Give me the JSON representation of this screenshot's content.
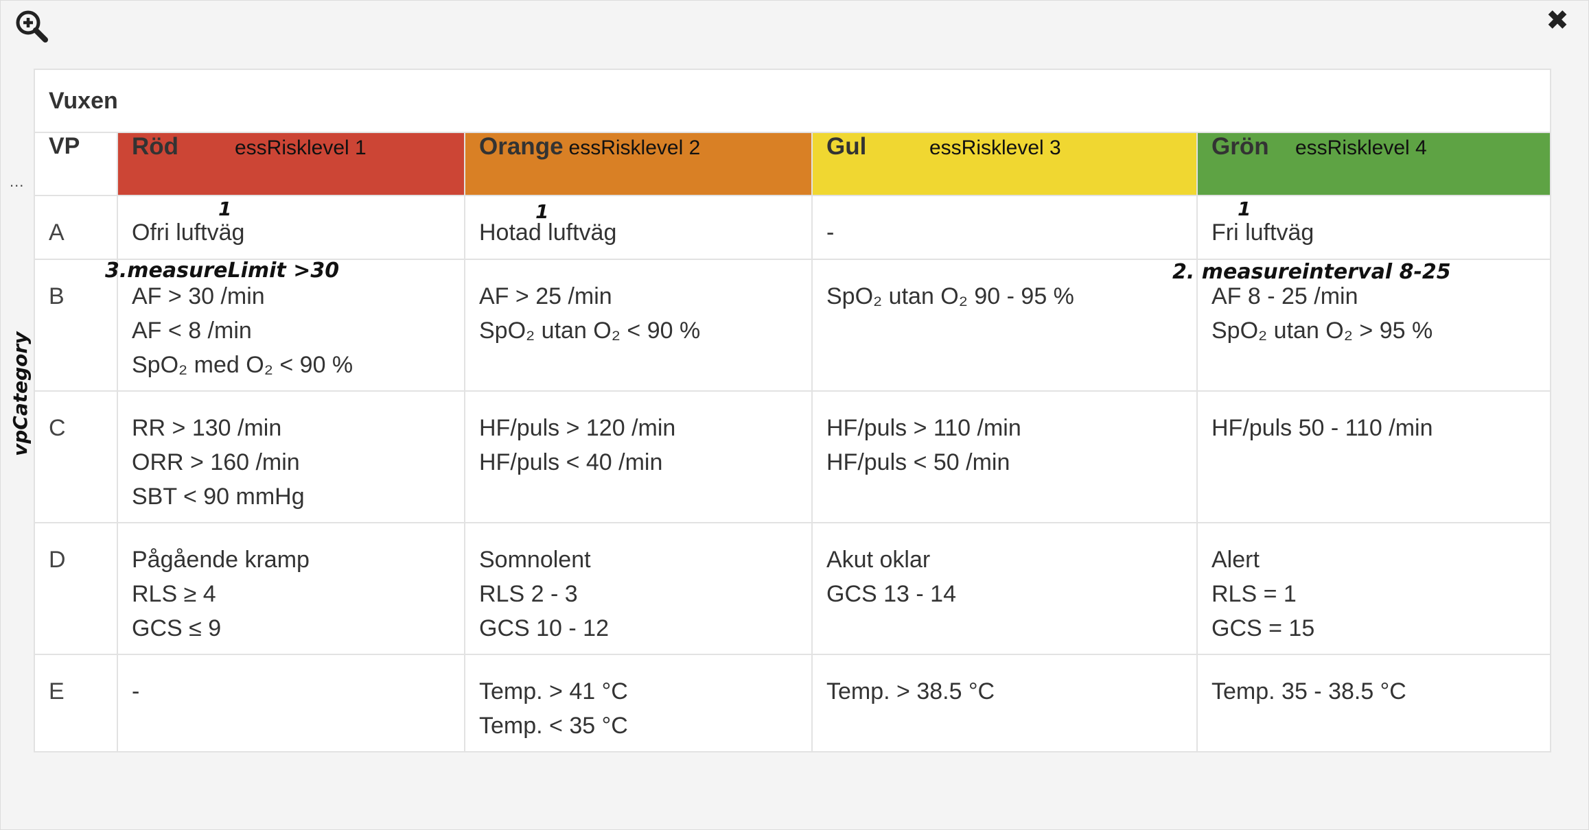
{
  "toolbar": {
    "zoom_icon": "zoom-in-icon",
    "close_icon": "close-icon",
    "close_glyph": "✖",
    "dots": "..."
  },
  "side_label": "vpCategory",
  "table": {
    "title": "Vuxen",
    "vp_header": "VP",
    "levels": [
      {
        "name": "Röd",
        "code": "essRisklevel 1",
        "color": "#cc4535"
      },
      {
        "name": "Orange",
        "code": "essRisklevel 2",
        "color": "#d98025"
      },
      {
        "name": "Gul",
        "code": "essRisklevel 3",
        "color": "#f0d731"
      },
      {
        "name": "Grön",
        "code": "essRisklevel 4",
        "color": "#5ea344"
      }
    ],
    "rows": [
      {
        "cat": "A",
        "cells": [
          [
            "Ofri luftväg"
          ],
          [
            "Hotad luftväg"
          ],
          [
            "-"
          ],
          [
            "Fri luftväg"
          ]
        ]
      },
      {
        "cat": "B",
        "cells": [
          [
            "AF > 30 /min",
            "AF < 8 /min",
            "SpO₂ med O₂ < 90 %"
          ],
          [
            "AF > 25 /min",
            "SpO₂ utan O₂ < 90 %"
          ],
          [
            "SpO₂ utan O₂ 90 - 95 %"
          ],
          [
            "AF 8 - 25 /min",
            "SpO₂ utan O₂ > 95 %"
          ]
        ]
      },
      {
        "cat": "C",
        "cells": [
          [
            "RR > 130 /min",
            "ORR > 160 /min",
            "SBT < 90 mmHg"
          ],
          [
            "HF/puls > 120 /min",
            "HF/puls < 40 /min"
          ],
          [
            "HF/puls > 110 /min",
            "HF/puls < 50 /min"
          ],
          [
            "HF/puls 50 - 110 /min"
          ]
        ]
      },
      {
        "cat": "D",
        "cells": [
          [
            "Pågående kramp",
            "RLS ≥ 4",
            "GCS ≤ 9"
          ],
          [
            "Somnolent",
            "RLS 2 - 3",
            "GCS 10 - 12"
          ],
          [
            "Akut oklar",
            "GCS 13 - 14"
          ],
          [
            "Alert",
            "RLS = 1",
            "GCS = 15"
          ]
        ]
      },
      {
        "cat": "E",
        "cells": [
          [
            "-"
          ],
          [
            "Temp. > 41 °C",
            "Temp. < 35 °C"
          ],
          [
            "Temp. > 38.5 °C"
          ],
          [
            "Temp. 35 - 38.5 °C"
          ]
        ]
      }
    ]
  },
  "annotations": {
    "a_red": "1",
    "a_orange": "1",
    "a_green": "1",
    "b_red": "3.measureLimit  >30",
    "b_green": "2. measureinterval 8-25"
  }
}
